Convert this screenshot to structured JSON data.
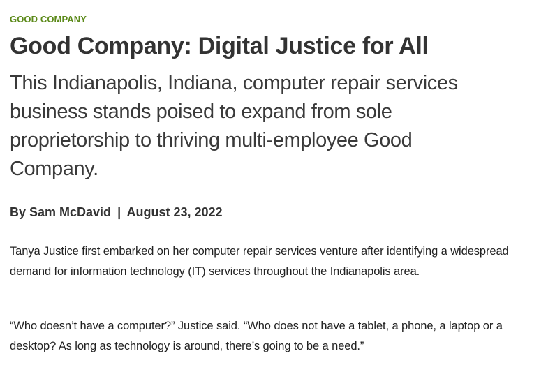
{
  "article": {
    "kicker": "GOOD COMPANY",
    "headline": "Good Company: Digital Justice for All",
    "dek": "This Indianapolis, Indiana, computer repair services business stands poised to expand from sole proprietorship to thriving multi-employee Good Company.",
    "byline": {
      "author": "By Sam McDavid",
      "separator": "|",
      "date": "August 23, 2022"
    },
    "paragraphs": [
      "Tanya Justice first embarked on her computer repair services venture after identifying a widespread demand for information technology (IT) services throughout the Indianapolis area.",
      "“Who doesn’t have a computer?” Justice said. “Who does not have a tablet, a phone, a laptop or a desktop? As long as technology is around, there’s going to be a need.”"
    ]
  },
  "colors": {
    "kicker": "#5c8a1a",
    "text": "#333333"
  }
}
